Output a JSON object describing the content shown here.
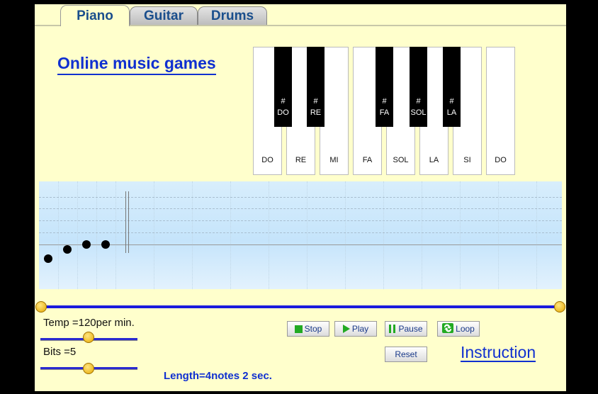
{
  "tabs": [
    {
      "label": "Piano",
      "active": true
    },
    {
      "label": "Guitar",
      "active": false
    },
    {
      "label": "Drums",
      "active": false
    }
  ],
  "title": "Online music games",
  "piano": {
    "white_keys": [
      "DO",
      "RE",
      "MI",
      "FA",
      "SOL",
      "LA",
      "SI",
      "DO"
    ],
    "black_keys": [
      {
        "sharp": "#",
        "label": "DO"
      },
      {
        "sharp": "#",
        "label": "RE"
      },
      {
        "sharp": "#",
        "label": "FA"
      },
      {
        "sharp": "#",
        "label": "SOL"
      },
      {
        "sharp": "#",
        "label": "LA"
      }
    ]
  },
  "controls": {
    "tempo_label": "Temp =120per min.",
    "bits_label": "Bits =5",
    "stop_label": "Stop",
    "play_label": "Play",
    "pause_label": "Pause",
    "loop_label": "Loop",
    "reset_label": "Reset",
    "instruction_label": "Instruction",
    "length_label": "Length=4notes 2 sec."
  },
  "colors": {
    "background": "#ffffcc",
    "accent": "#1030d0",
    "tab_text": "#1a4e8c",
    "stop_icon": "#22aa22",
    "play_icon": "#22aa22"
  }
}
